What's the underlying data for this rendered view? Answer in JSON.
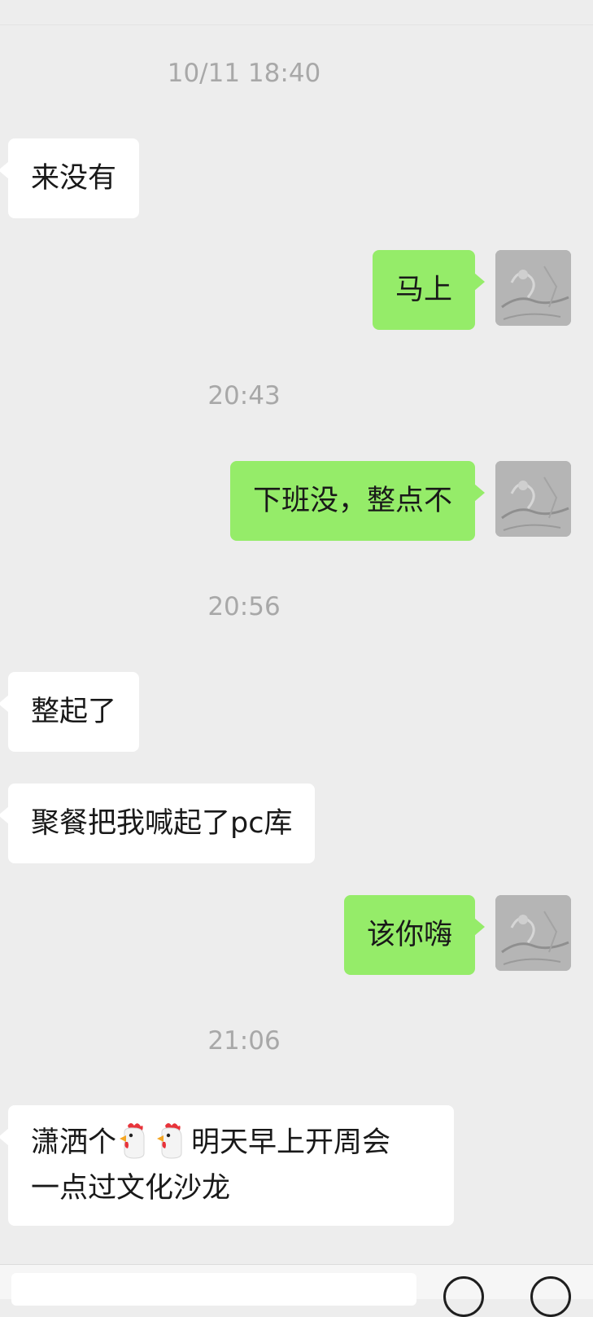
{
  "chat": {
    "timestamps": [
      "10/11 18:40",
      "20:43",
      "20:56",
      "21:06"
    ],
    "messages": [
      {
        "side": "incoming",
        "text": "来没有"
      },
      {
        "side": "outgoing",
        "text": "马上"
      },
      {
        "side": "outgoing",
        "text": "下班没，整点不"
      },
      {
        "side": "incoming",
        "text": "整起了"
      },
      {
        "side": "incoming",
        "text": "聚餐把我喊起了pc库"
      },
      {
        "side": "outgoing",
        "text": "该你嗨"
      },
      {
        "side": "incoming",
        "text_part1": "潇洒个",
        "emoji": "rooster-emoji",
        "text_part2": "明天早上开周会",
        "text_line2": "一点过文化沙龙"
      }
    ]
  },
  "colors": {
    "background": "#ededed",
    "incoming_bubble": "#ffffff",
    "outgoing_bubble": "#95ec69",
    "timestamp_text": "#a8a8a8",
    "message_text": "#191919"
  },
  "icons": [
    "user-avatar",
    "rooster-emoji",
    "voice-icon",
    "emoji-icon"
  ]
}
